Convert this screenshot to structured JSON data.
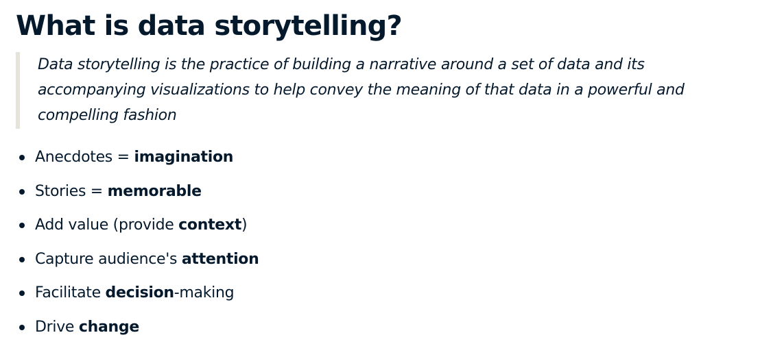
{
  "slide": {
    "title": "What is data storytelling?",
    "quote": "Data storytelling is the practice of building a narrative around a set of data and its accompanying visualizations to help convey the meaning of that data in a powerful and compelling fashion",
    "bullets": [
      {
        "before": "Anecdotes = ",
        "bold": "imagination",
        "after": ""
      },
      {
        "before": "Stories = ",
        "bold": "memorable",
        "after": ""
      },
      {
        "before": "Add value (provide ",
        "bold": "context",
        "after": ")"
      },
      {
        "before": "Capture audience's ",
        "bold": "attention",
        "after": ""
      },
      {
        "before": "Facilitate ",
        "bold": "decision",
        "after": "-making"
      },
      {
        "before": "Drive ",
        "bold": "change",
        "after": ""
      }
    ]
  },
  "colors": {
    "text": "#05192d",
    "quote_border": "#e6e2dc",
    "background": "#ffffff"
  }
}
